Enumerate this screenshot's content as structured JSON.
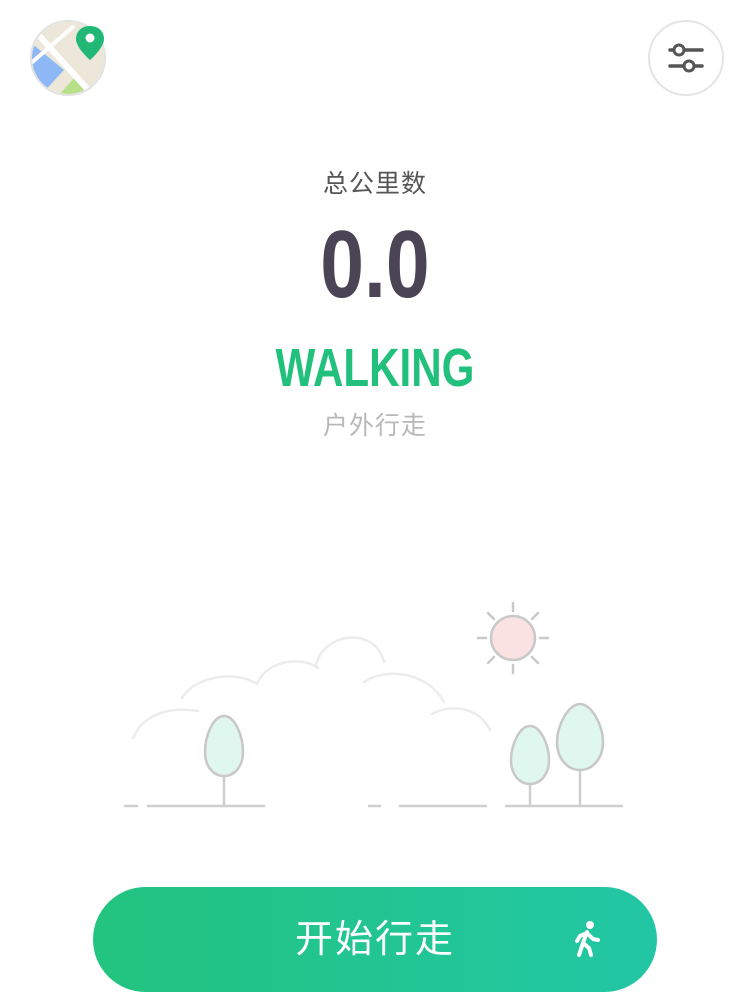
{
  "header": {
    "map_icon": "map-pin-icon",
    "settings_icon": "sliders-icon"
  },
  "stats": {
    "label": "总公里数",
    "value": "0.0"
  },
  "mode": {
    "title": "WALKING",
    "subtitle": "户外行走"
  },
  "scene": {
    "icons": [
      "cloud-icon",
      "sun-icon",
      "tree-icon"
    ]
  },
  "action": {
    "start_label": "开始行走",
    "icon": "walking-person-icon"
  },
  "colors": {
    "accent": "#22c07d",
    "gradient_end": "#22c6a4",
    "value_text": "#4a4455",
    "sun": "#fbe2e2",
    "tree_fill": "#dff7ee"
  }
}
